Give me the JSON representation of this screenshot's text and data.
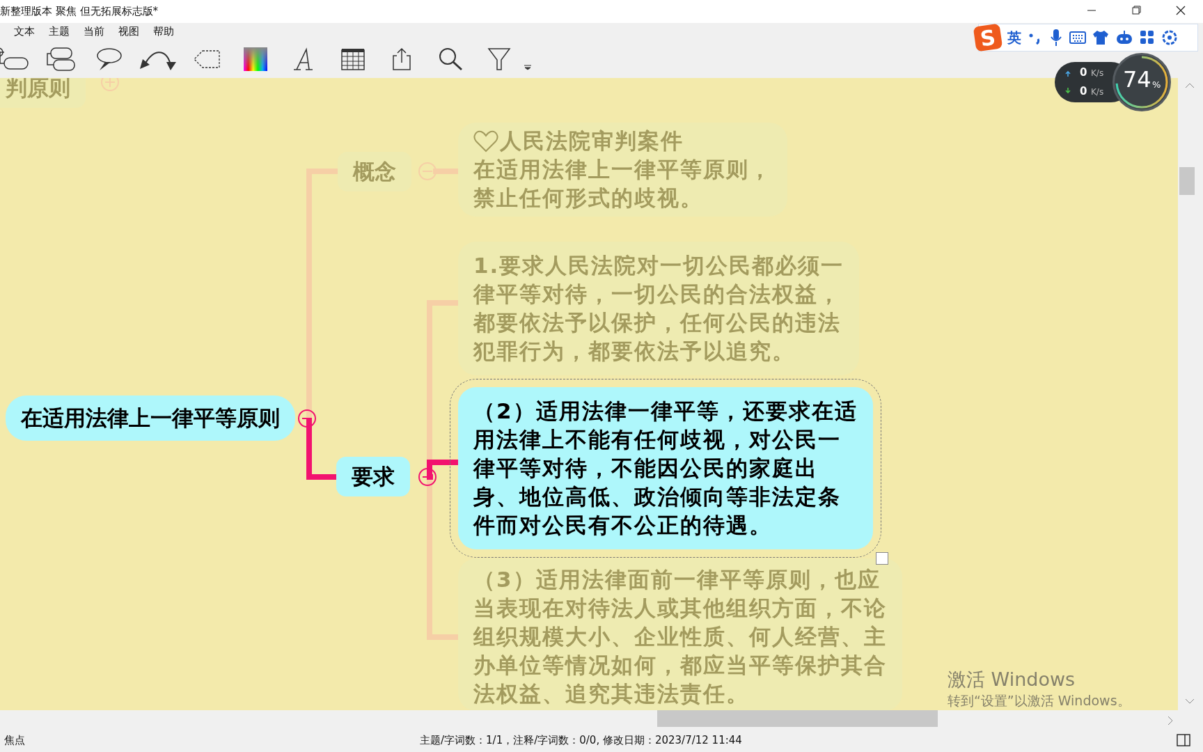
{
  "window": {
    "title": "新整理版本 聚焦 但无拓展标志版*"
  },
  "menu": [
    {
      "label": "文本"
    },
    {
      "label": "主题"
    },
    {
      "label": "当前"
    },
    {
      "label": "视图"
    },
    {
      "label": "帮助"
    }
  ],
  "ime_bar": {
    "logo": "S",
    "language": "英"
  },
  "net_monitor": {
    "upload": "0",
    "download": "0",
    "unit_up": "K/s",
    "unit_down": "K/s",
    "percent": "74",
    "percent_sign": "%"
  },
  "mindmap": {
    "collapsed_node": {
      "text": "判原则",
      "dimmed": true,
      "expanded": false
    },
    "root": {
      "text": "在适用法律上一律平等原则",
      "dimmed": false,
      "expanded": true,
      "children": [
        {
          "text": "概念",
          "dimmed": true,
          "expanded": true,
          "children": [
            {
              "kind": "icon-note",
              "lines": [
                "人民法院审判案件",
                "在适用法律上一律平等原则，",
                "禁止任何形式的歧视。"
              ],
              "dimmed": true,
              "selected": false
            }
          ]
        },
        {
          "text": "要求",
          "dimmed": false,
          "expanded": true,
          "children": [
            {
              "kind": "note",
              "lines": [
                "1.要求人民法院对一切公民都必须一",
                "律平等对待，一切公民的合法权益，",
                "都要依法予以保护，任何公民的违法",
                "犯罪行为，都要依法予以追究。"
              ],
              "dimmed": true,
              "selected": false
            },
            {
              "kind": "note",
              "lines": [
                "（2）适用法律一律平等，还要求在适",
                "用法律上不能有任何歧视，对公民一",
                "律平等对待，不能因公民的家庭出",
                "身、地位高低、政治倾向等非法定条",
                "件而对公民有不公正的待遇。"
              ],
              "dimmed": false,
              "selected": true
            },
            {
              "kind": "note",
              "lines": [
                "（3）适用法律面前一律平等原则，也应",
                "当表现在对待法人或其他组织方面，不论",
                "组织规模大小、企业性质、何人经营、主",
                "办单位等情况如何，都应当平等保护其合",
                "法权益、追究其违法责任。"
              ],
              "dimmed": true,
              "selected": false
            }
          ]
        }
      ]
    }
  },
  "watermark_os": {
    "title": "激活 Windows",
    "subtitle": "转到“设置”以激活 Windows。"
  },
  "status_bar": {
    "mode": "焦点",
    "info": "主题/字词数：1/1，注释/字词数：0/0, 修改日期：2023/7/12 11:44"
  }
}
